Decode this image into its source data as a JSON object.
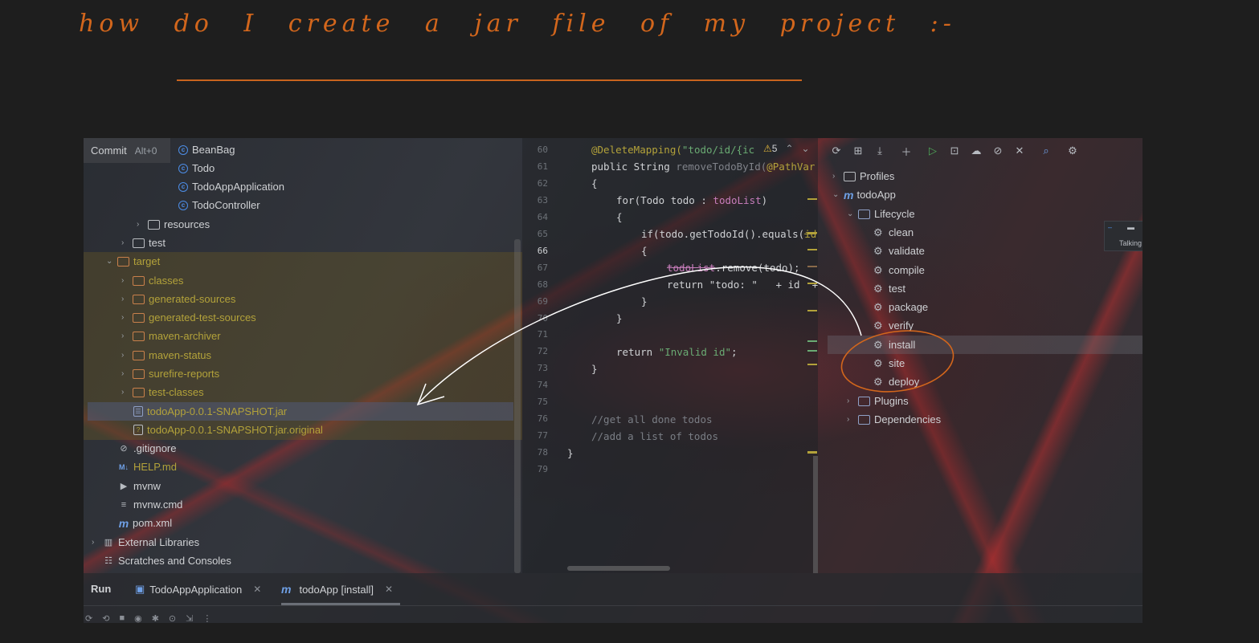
{
  "note": {
    "handwriting": "how do I create a jar file of my project :-"
  },
  "project_panel": {
    "commit_tab": {
      "label": "Commit",
      "shortcut": "Alt+0"
    },
    "classes": [
      "BeanBag",
      "Todo",
      "TodoAppApplication",
      "TodoController"
    ],
    "folders": {
      "resources": "resources",
      "test": "test",
      "target": "target"
    },
    "target_children": [
      "classes",
      "generated-sources",
      "generated-test-sources",
      "maven-archiver",
      "maven-status",
      "surefire-reports",
      "test-classes"
    ],
    "jar_file": "todoApp-0.0.1-SNAPSHOT.jar",
    "jar_original": "todoApp-0.0.1-SNAPSHOT.jar.original",
    "root_files": [
      ".gitignore",
      "HELP.md",
      "mvnw",
      "mvnw.cmd",
      "pom.xml"
    ],
    "external_libraries": "External Libraries",
    "scratches": "Scratches and Consoles"
  },
  "editor": {
    "line_numbers": [
      "60",
      "61",
      "62",
      "63",
      "64",
      "65",
      "66",
      "67",
      "68",
      "69",
      "70",
      "71",
      "72",
      "73",
      "74",
      "75",
      "76",
      "77",
      "78",
      "79"
    ],
    "current_line": "66",
    "warning_count": "5",
    "code": {
      "l60_ann": "@DeleteMapping(",
      "l60_str": "\"todo/id/{ic",
      "l61_a": "public String ",
      "l61_b": "removeTodoById(",
      "l61_c": "@PathVar",
      "l62": "{",
      "l63_a": "for(Todo todo : ",
      "l63_b": "todoList",
      "l63_c": ")",
      "l64": "{",
      "l65_a": "if(todo.getTodoId().equals(",
      "l65_b": "id",
      "l66": "{",
      "l67_a": "todoList",
      "l67_b": ".remove(todo);",
      "l68_a": "return ",
      "l68_b": "\"todo: \"",
      "l68_c": "   + id  +",
      "l69": "}",
      "l70": "}",
      "l72_a": "return ",
      "l72_b": "\"Invalid id\"",
      "l72_c": ";",
      "l73": "}",
      "l76": "//get all done todos",
      "l77": "//add a list of todos",
      "l78": "}"
    }
  },
  "maven": {
    "profiles": "Profiles",
    "project": "todoApp",
    "lifecycle": "Lifecycle",
    "phases": [
      "clean",
      "validate",
      "compile",
      "test",
      "package",
      "verify",
      "install",
      "site",
      "deploy"
    ],
    "plugins": "Plugins",
    "dependencies": "Dependencies",
    "mini_popup_text": "Talking"
  },
  "run_bar": {
    "title": "Run",
    "tabs": [
      {
        "label": "TodoAppApplication"
      },
      {
        "label": "todoApp [install]"
      }
    ]
  },
  "annotation_colors": {
    "ink": "#d2661c",
    "arrow": "#ffffff"
  }
}
